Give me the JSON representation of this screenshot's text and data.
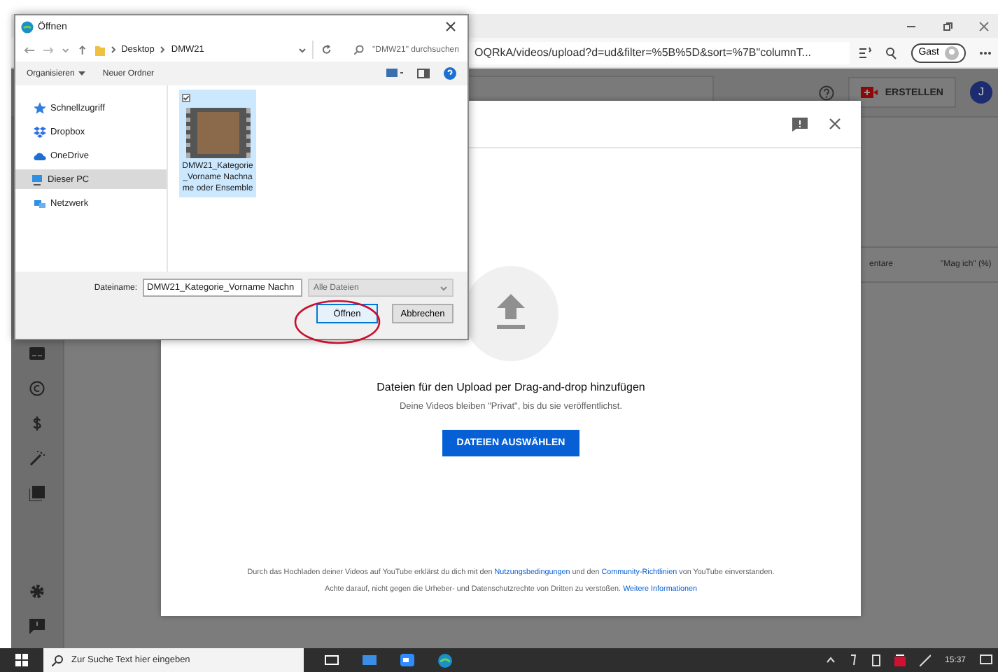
{
  "browser": {
    "address": "OQRkA/videos/upload?d=ud&filter=%5B%5D&sort=%7B\"columnT...",
    "profile": "Gast"
  },
  "studio": {
    "create_button": "ERSTELLEN",
    "avatar": "J",
    "columns": [
      "entare",
      "\"Mag ich\" (%)"
    ]
  },
  "upload_dialog": {
    "heading": "Dateien für den Upload per Drag-and-drop hinzufügen",
    "subtext": "Deine Videos bleiben \"Privat\", bis du sie veröffentlichst.",
    "button": "DATEIEN AUSWÄHLEN",
    "legal": [
      {
        "parts": [
          {
            "text": "Durch das Hochladen deiner Videos auf YouTube erklärst du dich mit den ",
            "link": false
          },
          {
            "text": "Nutzungsbedingungen",
            "link": true
          },
          {
            "text": " und den ",
            "link": false
          },
          {
            "text": "Community-Richtlinien",
            "link": true
          },
          {
            "text": " von YouTube einverstanden.",
            "link": false
          }
        ]
      },
      {
        "parts": [
          {
            "text": "Achte darauf, nicht gegen die Urheber- und Datenschutzrechte von Dritten zu verstoßen. ",
            "link": false
          },
          {
            "text": "Weitere Informationen",
            "link": true
          }
        ]
      }
    ]
  },
  "file_dialog": {
    "title": "Öffnen",
    "path": [
      "Desktop",
      "DMW21"
    ],
    "search_placeholder": "\"DMW21\" durchsuchen",
    "toolbar": [
      "Organisieren",
      "Neuer Ordner"
    ],
    "sidebar": [
      {
        "label": "Schnellzugriff",
        "selected": false
      },
      {
        "label": "Dropbox",
        "selected": false
      },
      {
        "label": "OneDrive",
        "selected": false
      },
      {
        "label": "Dieser PC",
        "selected": true
      },
      {
        "label": "Netzwerk",
        "selected": false
      }
    ],
    "files": [
      {
        "name": "DMW21_Kategorie_Vorname Nachname oder Ensemble",
        "selected": true
      }
    ],
    "filename_label": "Dateiname:",
    "filename": "DMW21_Kategorie_Vorname Nachn",
    "filetype": "Alle Dateien",
    "buttons": [
      "Öffnen",
      "Abbrechen"
    ]
  },
  "taskbar": {
    "search_placeholder": "Zur Suche Text hier eingeben",
    "time": "15:37"
  }
}
